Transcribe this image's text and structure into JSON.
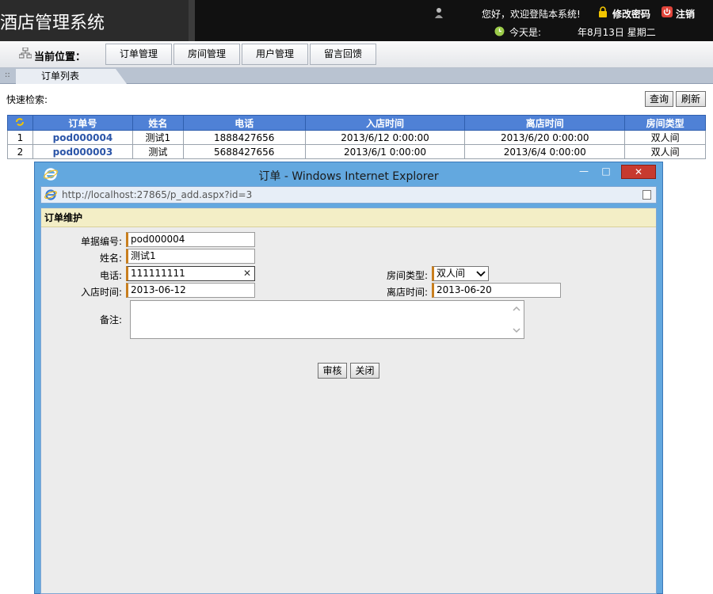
{
  "header": {
    "app_title": "酒店管理系统",
    "welcome": "您好，欢迎登陆本系统!",
    "change_password": "修改密码",
    "logout": "注销",
    "today_label": "今天是:",
    "date": "年8月13日 星期二"
  },
  "nav": {
    "location_label": "当前位置：",
    "tabs": [
      "订单管理",
      "房间管理",
      "用户管理",
      "留言回馈"
    ]
  },
  "list_tab": {
    "label": "订单列表"
  },
  "search": {
    "label": "快速检索:",
    "query_button": "查询",
    "refresh_button": "刷新"
  },
  "orders_table": {
    "headers": [
      "",
      "订单号",
      "姓名",
      "电话",
      "入店时间",
      "离店时间",
      "房间类型"
    ],
    "rows": [
      {
        "index": "1",
        "order_no": "pod000004",
        "name": "测试1",
        "phone": "1888427656",
        "checkin": "2013/6/12 0:00:00",
        "checkout": "2013/6/20 0:00:00",
        "room_type": "双人间"
      },
      {
        "index": "2",
        "order_no": "pod000003",
        "name": "测试",
        "phone": "5688427656",
        "checkin": "2013/6/1 0:00:00",
        "checkout": "2013/6/4 0:00:00",
        "room_type": "双人间"
      }
    ]
  },
  "dialog": {
    "title": "订单 - Windows Internet Explorer",
    "url": "http://localhost:27865/p_add.aspx?id=3",
    "panel_title": "订单维护",
    "labels": {
      "doc_no": "单据编号:",
      "name": "姓名:",
      "phone": "电话:",
      "checkin": "入店时间:",
      "room_type": "房间类型:",
      "checkout": "离店时间:",
      "remarks": "备注:"
    },
    "values": {
      "doc_no": "pod000004",
      "name": "测试1",
      "phone": "111111111",
      "checkin": "2013-06-12",
      "room_type": "双人间",
      "checkout": "2013-06-20",
      "remarks": ""
    },
    "buttons": {
      "audit": "审核",
      "close": "关闭"
    }
  },
  "colors": {
    "header_bg": "#111111",
    "table_header": "#4f81d6",
    "link": "#2b55a8",
    "ie_frame": "#63a8df",
    "required_marker": "#c97f1e",
    "panel_head": "#f3eec6"
  }
}
